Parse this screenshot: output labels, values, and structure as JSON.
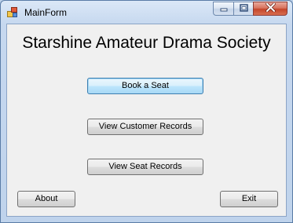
{
  "window": {
    "title": "MainForm",
    "app_icon": "windows-form-icon",
    "controls": {
      "minimize_icon": "minimize-icon",
      "maximize_icon": "maximize-icon",
      "close_icon": "close-icon"
    }
  },
  "main": {
    "heading": "Starshine Amateur Drama Society",
    "buttons": {
      "book_seat": "Book a Seat",
      "view_customer_records": "View Customer Records",
      "view_seat_records": "View Seat Records",
      "about": "About",
      "exit": "Exit"
    }
  },
  "colors": {
    "titlebar": "#c6d8ef",
    "client_background": "#f0f0f0",
    "close_button": "#c4452a",
    "focused_button_border": "#3c7fb1"
  }
}
